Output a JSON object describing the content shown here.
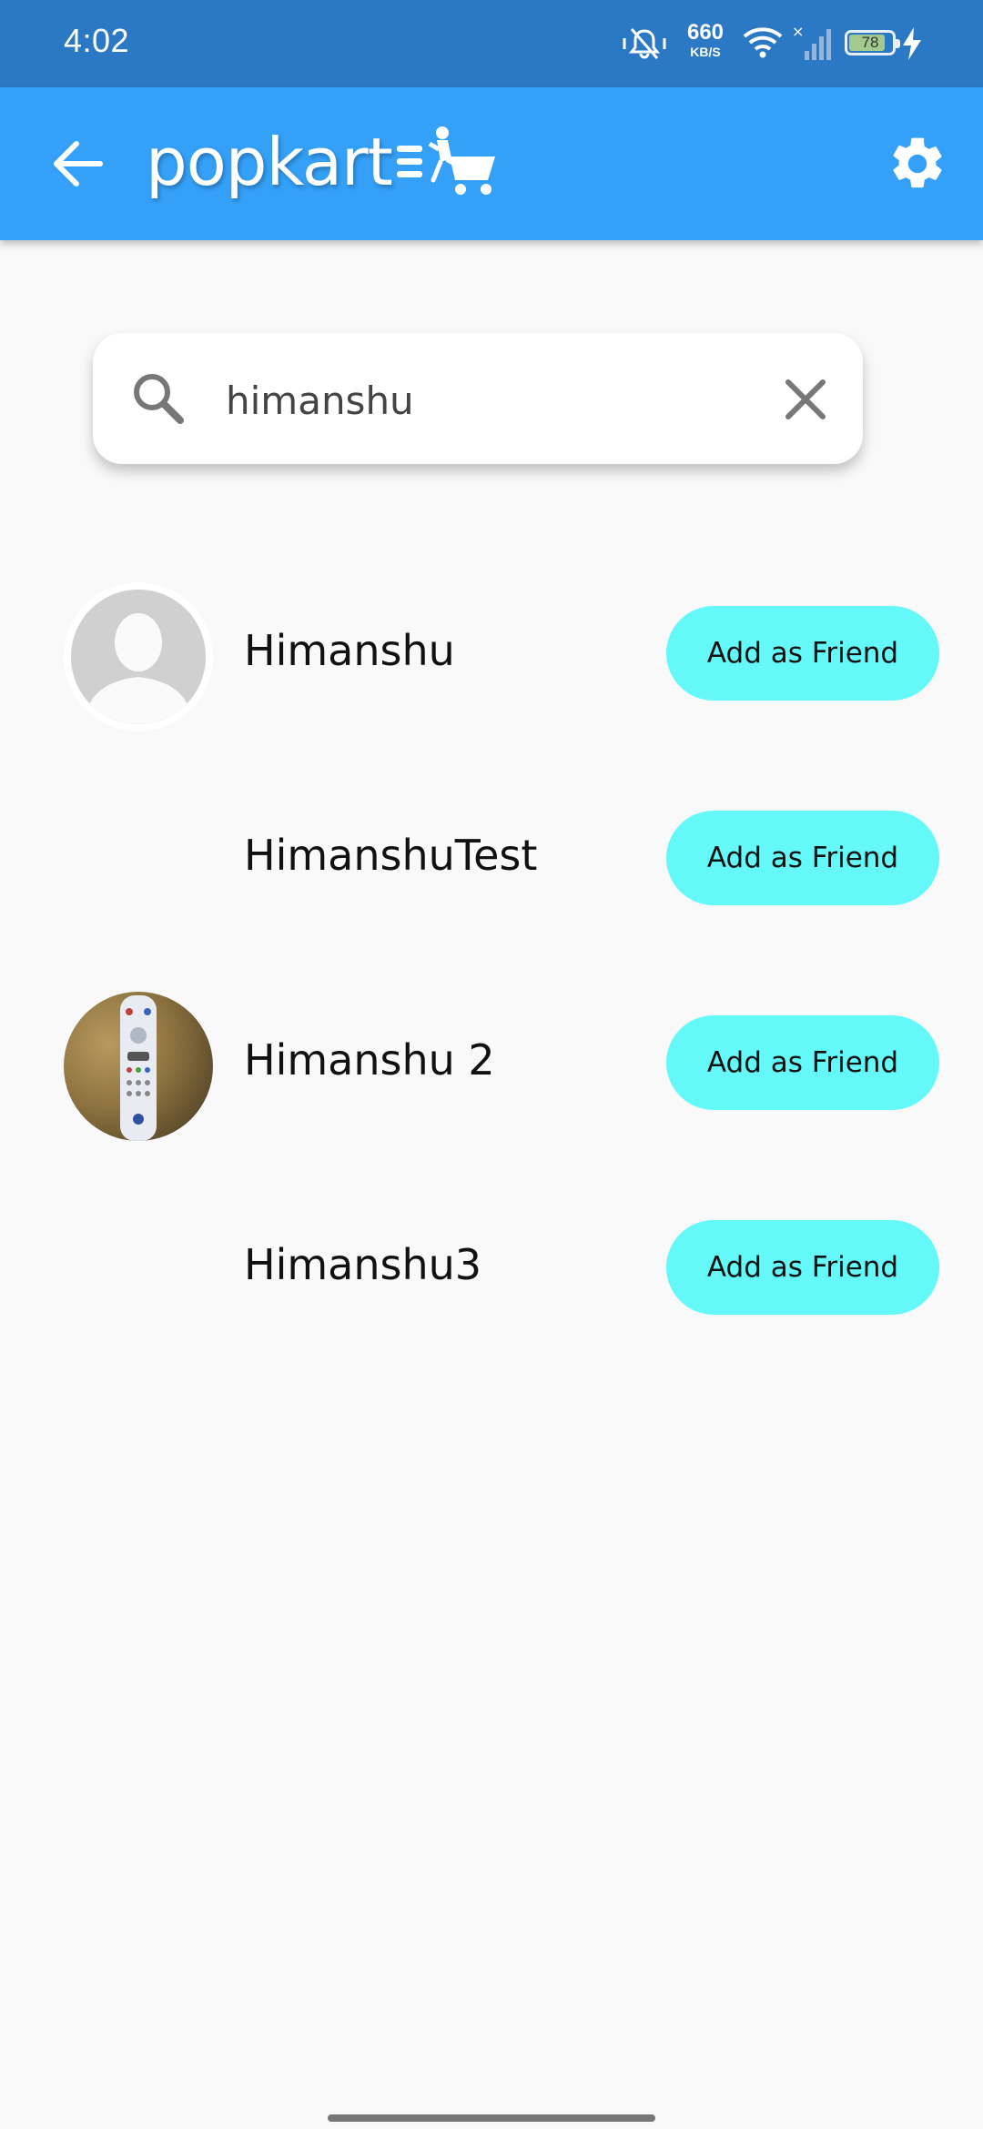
{
  "status_bar": {
    "time": "4:02",
    "net_speed": "660",
    "net_unit": "KB/S",
    "battery": "78"
  },
  "app_bar": {
    "brand": "popkart",
    "accent": "#34a0f8"
  },
  "search": {
    "query": "himanshu",
    "icon": "search-icon",
    "clear_icon": "close-icon"
  },
  "results": [
    {
      "name": "Himanshu",
      "avatar": "placeholder",
      "action": "Add as Friend"
    },
    {
      "name": "HimanshuTest",
      "avatar": "none",
      "action": "Add as Friend"
    },
    {
      "name": "Himanshu 2",
      "avatar": "photo",
      "action": "Add as Friend"
    },
    {
      "name": "Himanshu3",
      "avatar": "none",
      "action": "Add as Friend"
    }
  ],
  "colors": {
    "status_bar": "#2b79c4",
    "button": "#65f8f8",
    "background": "#f9f9f9"
  }
}
